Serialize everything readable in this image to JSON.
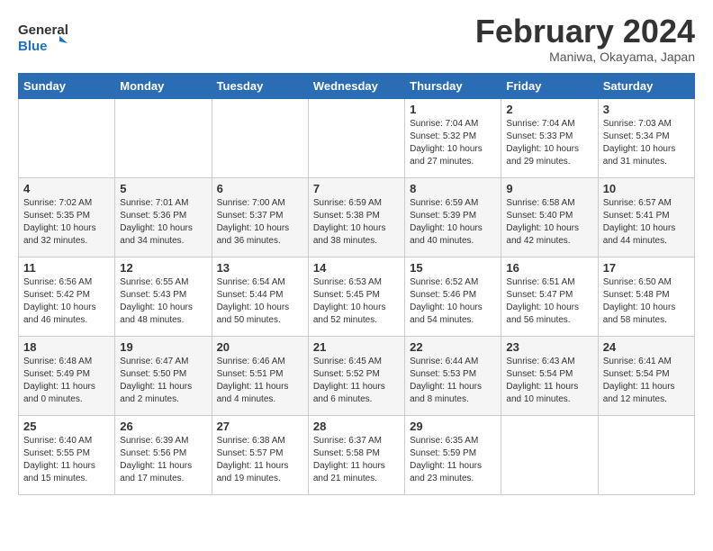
{
  "logo": {
    "line1": "General",
    "line2": "Blue"
  },
  "title": "February 2024",
  "subtitle": "Maniwa, Okayama, Japan",
  "days_header": [
    "Sunday",
    "Monday",
    "Tuesday",
    "Wednesday",
    "Thursday",
    "Friday",
    "Saturday"
  ],
  "weeks": [
    [
      {
        "day": "",
        "detail": ""
      },
      {
        "day": "",
        "detail": ""
      },
      {
        "day": "",
        "detail": ""
      },
      {
        "day": "",
        "detail": ""
      },
      {
        "day": "1",
        "detail": "Sunrise: 7:04 AM\nSunset: 5:32 PM\nDaylight: 10 hours\nand 27 minutes."
      },
      {
        "day": "2",
        "detail": "Sunrise: 7:04 AM\nSunset: 5:33 PM\nDaylight: 10 hours\nand 29 minutes."
      },
      {
        "day": "3",
        "detail": "Sunrise: 7:03 AM\nSunset: 5:34 PM\nDaylight: 10 hours\nand 31 minutes."
      }
    ],
    [
      {
        "day": "4",
        "detail": "Sunrise: 7:02 AM\nSunset: 5:35 PM\nDaylight: 10 hours\nand 32 minutes."
      },
      {
        "day": "5",
        "detail": "Sunrise: 7:01 AM\nSunset: 5:36 PM\nDaylight: 10 hours\nand 34 minutes."
      },
      {
        "day": "6",
        "detail": "Sunrise: 7:00 AM\nSunset: 5:37 PM\nDaylight: 10 hours\nand 36 minutes."
      },
      {
        "day": "7",
        "detail": "Sunrise: 6:59 AM\nSunset: 5:38 PM\nDaylight: 10 hours\nand 38 minutes."
      },
      {
        "day": "8",
        "detail": "Sunrise: 6:59 AM\nSunset: 5:39 PM\nDaylight: 10 hours\nand 40 minutes."
      },
      {
        "day": "9",
        "detail": "Sunrise: 6:58 AM\nSunset: 5:40 PM\nDaylight: 10 hours\nand 42 minutes."
      },
      {
        "day": "10",
        "detail": "Sunrise: 6:57 AM\nSunset: 5:41 PM\nDaylight: 10 hours\nand 44 minutes."
      }
    ],
    [
      {
        "day": "11",
        "detail": "Sunrise: 6:56 AM\nSunset: 5:42 PM\nDaylight: 10 hours\nand 46 minutes."
      },
      {
        "day": "12",
        "detail": "Sunrise: 6:55 AM\nSunset: 5:43 PM\nDaylight: 10 hours\nand 48 minutes."
      },
      {
        "day": "13",
        "detail": "Sunrise: 6:54 AM\nSunset: 5:44 PM\nDaylight: 10 hours\nand 50 minutes."
      },
      {
        "day": "14",
        "detail": "Sunrise: 6:53 AM\nSunset: 5:45 PM\nDaylight: 10 hours\nand 52 minutes."
      },
      {
        "day": "15",
        "detail": "Sunrise: 6:52 AM\nSunset: 5:46 PM\nDaylight: 10 hours\nand 54 minutes."
      },
      {
        "day": "16",
        "detail": "Sunrise: 6:51 AM\nSunset: 5:47 PM\nDaylight: 10 hours\nand 56 minutes."
      },
      {
        "day": "17",
        "detail": "Sunrise: 6:50 AM\nSunset: 5:48 PM\nDaylight: 10 hours\nand 58 minutes."
      }
    ],
    [
      {
        "day": "18",
        "detail": "Sunrise: 6:48 AM\nSunset: 5:49 PM\nDaylight: 11 hours\nand 0 minutes."
      },
      {
        "day": "19",
        "detail": "Sunrise: 6:47 AM\nSunset: 5:50 PM\nDaylight: 11 hours\nand 2 minutes."
      },
      {
        "day": "20",
        "detail": "Sunrise: 6:46 AM\nSunset: 5:51 PM\nDaylight: 11 hours\nand 4 minutes."
      },
      {
        "day": "21",
        "detail": "Sunrise: 6:45 AM\nSunset: 5:52 PM\nDaylight: 11 hours\nand 6 minutes."
      },
      {
        "day": "22",
        "detail": "Sunrise: 6:44 AM\nSunset: 5:53 PM\nDaylight: 11 hours\nand 8 minutes."
      },
      {
        "day": "23",
        "detail": "Sunrise: 6:43 AM\nSunset: 5:54 PM\nDaylight: 11 hours\nand 10 minutes."
      },
      {
        "day": "24",
        "detail": "Sunrise: 6:41 AM\nSunset: 5:54 PM\nDaylight: 11 hours\nand 12 minutes."
      }
    ],
    [
      {
        "day": "25",
        "detail": "Sunrise: 6:40 AM\nSunset: 5:55 PM\nDaylight: 11 hours\nand 15 minutes."
      },
      {
        "day": "26",
        "detail": "Sunrise: 6:39 AM\nSunset: 5:56 PM\nDaylight: 11 hours\nand 17 minutes."
      },
      {
        "day": "27",
        "detail": "Sunrise: 6:38 AM\nSunset: 5:57 PM\nDaylight: 11 hours\nand 19 minutes."
      },
      {
        "day": "28",
        "detail": "Sunrise: 6:37 AM\nSunset: 5:58 PM\nDaylight: 11 hours\nand 21 minutes."
      },
      {
        "day": "29",
        "detail": "Sunrise: 6:35 AM\nSunset: 5:59 PM\nDaylight: 11 hours\nand 23 minutes."
      },
      {
        "day": "",
        "detail": ""
      },
      {
        "day": "",
        "detail": ""
      }
    ]
  ]
}
